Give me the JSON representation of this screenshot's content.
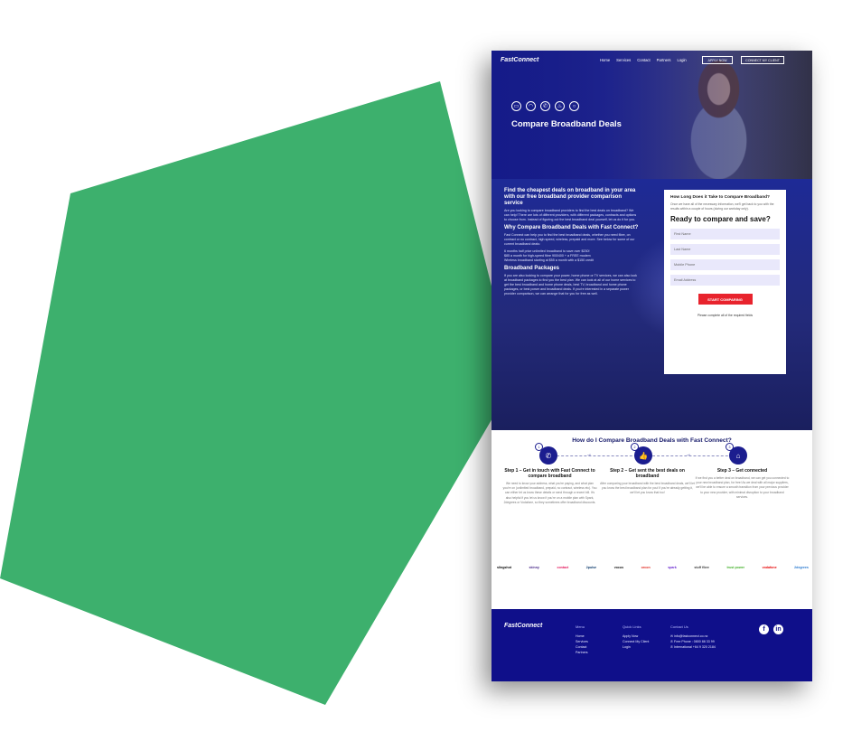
{
  "colors": {
    "background_shape": "#3db06d",
    "brand_blue": "#1b1d8f",
    "cta_red": "#e8232d",
    "footer": "#0f0f8a"
  },
  "nav": {
    "logo": "FastConnect",
    "links": [
      "Home",
      "Services",
      "Contact",
      "Partners",
      "Login"
    ],
    "apply_label": "APPLY NOW",
    "connect_label": "CONNECT MY CLIENT"
  },
  "hero": {
    "icons": [
      "tv-icon",
      "wifi-icon",
      "phone-icon",
      "flame-icon",
      "bulb-icon"
    ],
    "title": "Compare Broadband Deals"
  },
  "content": {
    "h1": "Find the cheapest deals on broadband in your area with our free broadband provider comparison service",
    "p1": "Are you looking to compare broadband providers to find the best deals on broadband? We can help! There are lots of different providers, with different packages, contracts and options to choose from. Instead of figuring out the best broadband deal yourself, let us do it for you.",
    "h2": "Why Compare Broadband Deals with Fast Connect?",
    "p2": "Fast Connect can help you to find the best broadband deals, whether you need fibre, on contract or no contract, high speed, wireless, prepaid and more. See below for some of our current broadband deals:",
    "deals": [
      "6 months half price unlimited broadband to save over $230!",
      "$85 a month for high-speed fibre 900/400 + a FREE modem",
      "Wireless broadband starting at $55 a month with a $150 credit"
    ],
    "h3": "Broadband Packages",
    "p3": "If you are also looking to compare your power, home phone or TV services, we can also look at broadband packages to find you the best plan. We can look at all of our home services to get the best broadband and home phone deals, best TV, broadband and home phone packages, or best power and broadband deals. If you're interested in a separate power provider comparison, we can arrange that for you for free as well."
  },
  "form": {
    "q_title": "How Long Does it Take to Compare Broadband?",
    "q_text": "Once we have all of the necessary information, we'll get back to you with the results within a couple of hours (during our workday only).",
    "title": "Ready to compare and save?",
    "fields": [
      "First Name",
      "Last Name",
      "Mobile Phone",
      "Email Address"
    ],
    "button": "START COMPARING",
    "note": "Please complete all of the required fields"
  },
  "steps": {
    "title": "How do I Compare Broadband Deals with Fast Connect?",
    "items": [
      {
        "num": "1",
        "title": "Step 1 – Get in touch with Fast Connect to compare broadband",
        "text": "We need to know your address, what you're paying, and what plan you're on (unlimited broadband, prepaid, no contract, wireless etc). You can either let us know these details or send through a recent bill. It's also helpful if you let us know if you're on a mobile plan with Spark, 2degrees or Vodafone, so they sometimes offer broadband discounts."
      },
      {
        "num": "2",
        "title": "Step 2 – Get sent the best deals on broadband",
        "text": "After comparing your broadband with the best broadband deals, we'll let you know the best broadband plan for you! If you're already getting it, we'll let you know that too!"
      },
      {
        "num": "3",
        "title": "Step 3 – Get connected",
        "text": "If we find you a better deal on broadband, we can get you connected to your new broadband plan, for free! As we deal with all major suppliers, we'll be able to ensure a smooth transition from your previous provider to your new provider, with minimal disruption to your broadband services."
      }
    ]
  },
  "partners": [
    "slingshot",
    "skinny",
    "contact",
    "2pulse",
    "vocus",
    "orcon",
    "spark",
    "stuff fibre",
    "trust power",
    "vodafone",
    "2degrees"
  ],
  "footer": {
    "logo": "FastConnect",
    "menu_title": "Menu",
    "menu": [
      "Home",
      "Services",
      "Contact",
      "Partners"
    ],
    "quick_title": "Quick Links",
    "quick": [
      "Apply Now",
      "Connect My Client",
      "Login"
    ],
    "contact_title": "Contact Us",
    "contact": [
      "info@fastconnect.co.nz",
      "Free Phone : 0800 88 33 99",
      "International +64 9 320 2184"
    ]
  }
}
